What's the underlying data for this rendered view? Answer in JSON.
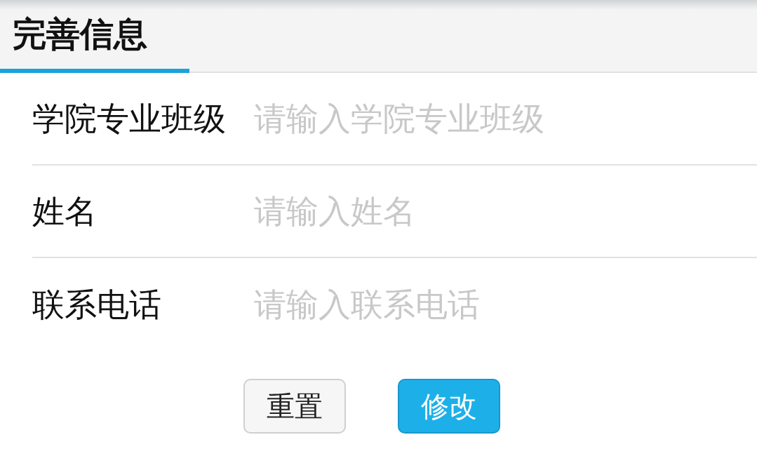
{
  "header": {
    "title": "完善信息"
  },
  "fields": [
    {
      "label": "学院专业班级",
      "placeholder": "请输入学院专业班级"
    },
    {
      "label": "姓名",
      "placeholder": "请输入姓名"
    },
    {
      "label": "联系电话",
      "placeholder": "请输入联系电话"
    }
  ],
  "buttons": [
    {
      "label": "重置",
      "kind": "secondary"
    },
    {
      "label": "修改",
      "kind": "primary"
    }
  ]
}
